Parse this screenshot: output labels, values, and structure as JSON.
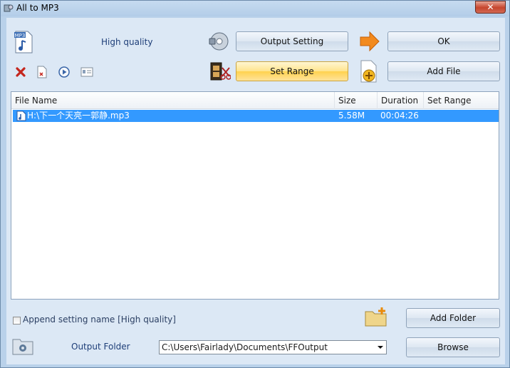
{
  "window": {
    "title": "All to MP3",
    "close_glyph": "✕"
  },
  "toolbar": {
    "quality_label": "High quality",
    "output_setting_label": "Output Setting",
    "ok_label": "OK",
    "set_range_label": "Set Range",
    "add_file_label": "Add File",
    "icons": [
      "mp3-file-icon",
      "delete-icon",
      "clear-list-icon",
      "play-icon",
      "info-icon",
      "settings-disc-icon",
      "arrow-right-icon",
      "film-cut-icon",
      "add-file-icon"
    ]
  },
  "file_list": {
    "columns": [
      "File Name",
      "Size",
      "Duration",
      "Set Range"
    ],
    "rows": [
      {
        "name": "H:\\下一个天亮一郭静.mp3",
        "size": "5.58M",
        "duration": "00:04:26",
        "range": ""
      }
    ]
  },
  "append_setting": {
    "label": "Append setting name [High quality]",
    "checked": false
  },
  "add_folder_label": "Add Folder",
  "output": {
    "label": "Output Folder",
    "path": "C:\\Users\\Fairlady\\Documents\\FFOutput",
    "browse_label": "Browse"
  },
  "colors": {
    "accent": "#3399ff",
    "window_bg": "#dce8f5",
    "hot_button": "#ffd24f",
    "arrow": "#f28a1e"
  }
}
